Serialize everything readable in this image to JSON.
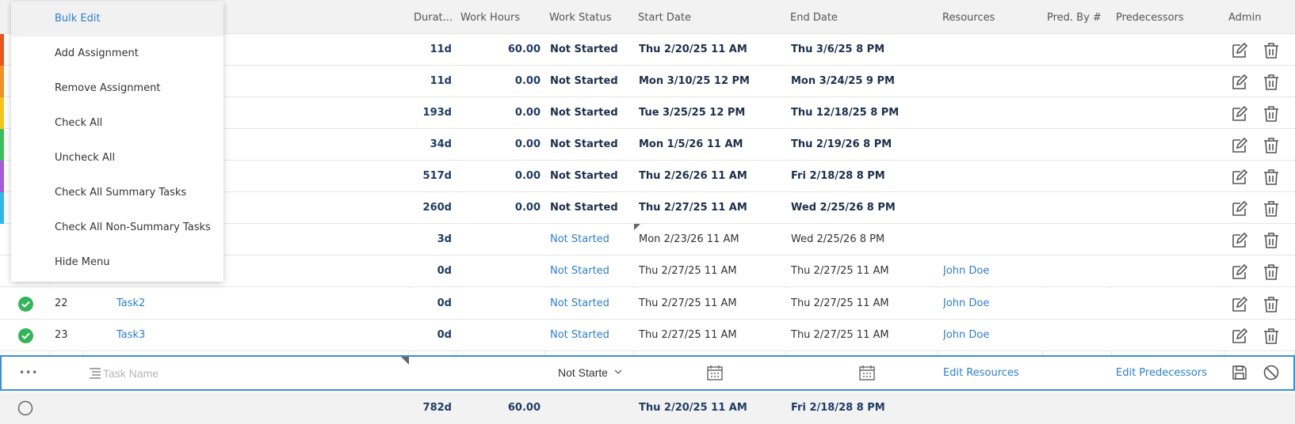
{
  "columns": {
    "duration": "Durat...",
    "work_hours": "Work Hours",
    "work_status": "Work Status",
    "start_date": "Start Date",
    "end_date": "End Date",
    "resources": "Resources",
    "pred_by": "Pred. By #",
    "predecessors": "Predecessors",
    "admin": "Admin"
  },
  "colors": {
    "accent": "#2e7fc8",
    "check": "#36b35a",
    "row_bars": [
      "#e8551f",
      "#f0902a",
      "#f7c31d",
      "#3cbf5a",
      "#a85bd6",
      "#2fb7e6"
    ]
  },
  "menu": {
    "items": [
      "Bulk Edit",
      "Add Assignment",
      "Remove Assignment",
      "Check All",
      "Uncheck All",
      "Check All Summary Tasks",
      "Check All Non-Summary Tasks",
      "Hide Menu"
    ]
  },
  "rows": [
    {
      "duration": "11d",
      "work_hours": "60.00",
      "status": "Not Started",
      "start": "Thu 2/20/25 11 AM",
      "end": "Thu 3/6/25 8 PM"
    },
    {
      "duration": "11d",
      "work_hours": "0.00",
      "status": "Not Started",
      "start": "Mon 3/10/25 12 PM",
      "end": "Mon 3/24/25 9 PM"
    },
    {
      "duration": "193d",
      "work_hours": "0.00",
      "status": "Not Started",
      "start": "Tue 3/25/25 12 PM",
      "end": "Thu 12/18/25 8 PM"
    },
    {
      "duration": "34d",
      "work_hours": "0.00",
      "status": "Not Started",
      "start": "Mon 1/5/26 11 AM",
      "end": "Thu 2/19/26 8 PM"
    },
    {
      "duration": "517d",
      "work_hours": "0.00",
      "status": "Not Started",
      "start": "Thu 2/26/26 11 AM",
      "end": "Fri 2/18/28 8 PM"
    },
    {
      "duration": "260d",
      "work_hours": "0.00",
      "status": "Not Started",
      "start": "Thu 2/27/25 11 AM",
      "end": "Wed 2/25/26 8 PM"
    },
    {
      "duration": "3d",
      "status": "Not Started",
      "start": "Mon 2/23/26 11 AM",
      "end": "Wed 2/25/26 8 PM"
    },
    {
      "duration": "0d",
      "status": "Not Started",
      "start": "Thu 2/27/25 11 AM",
      "end": "Thu 2/27/25 11 AM",
      "resource": "John Doe"
    },
    {
      "id": "22",
      "name": "Task2",
      "duration": "0d",
      "status": "Not Started",
      "start": "Thu 2/27/25 11 AM",
      "end": "Thu 2/27/25 11 AM",
      "resource": "John Doe"
    },
    {
      "id": "23",
      "name": "Task3",
      "duration": "0d",
      "status": "Not Started",
      "start": "Thu 2/27/25 11 AM",
      "end": "Thu 2/27/25 11 AM",
      "resource": "John Doe"
    }
  ],
  "new_row": {
    "more": "•••",
    "name_placeholder": "Task Name",
    "status": "Not Starte",
    "edit_resources": "Edit Resources",
    "edit_predecessors": "Edit Predecessors"
  },
  "footer": {
    "duration": "782d",
    "work_hours": "60.00",
    "start": "Thu 2/20/25 11 AM",
    "end": "Fri 2/18/28 8 PM"
  }
}
